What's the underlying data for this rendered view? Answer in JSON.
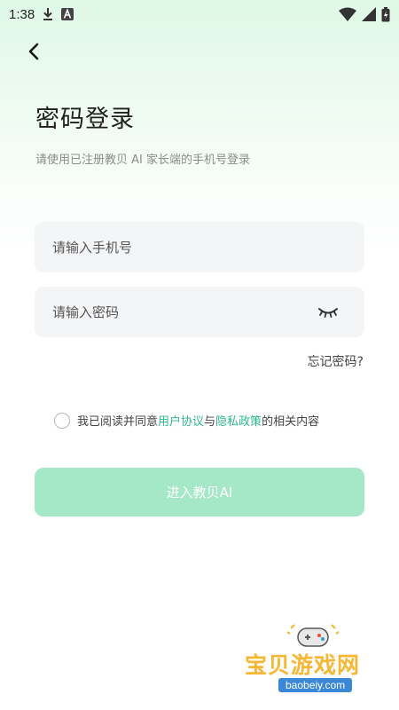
{
  "status_bar": {
    "time": "1:38",
    "icons": [
      "download-icon",
      "a-icon",
      "wifi-icon",
      "battery-icon"
    ]
  },
  "nav": {
    "back_icon": "chevron-left-icon"
  },
  "header": {
    "title": "密码登录",
    "subtitle": "请使用已注册教贝 AI 家长端的手机号登录"
  },
  "form": {
    "phone_placeholder": "请输入手机号",
    "password_placeholder": "请输入密码",
    "password_toggle_icon": "eye-closed-icon",
    "forgot_label": "忘记密码?"
  },
  "agreement": {
    "prefix": "我已阅读并同意",
    "user_agreement": "用户协议",
    "and": "与",
    "privacy_policy": "隐私政策",
    "suffix": "的相关内容",
    "checked": false
  },
  "submit": {
    "label": "进入教贝AI"
  },
  "watermark": {
    "title": "宝贝游戏网",
    "url": "baobeiy.com"
  },
  "colors": {
    "accent": "#2fb98a",
    "button_disabled": "#a4e8c8",
    "field_bg": "#f4f5f7",
    "watermark_text": "#f7b733",
    "watermark_url_bg": "#3b88d6"
  }
}
